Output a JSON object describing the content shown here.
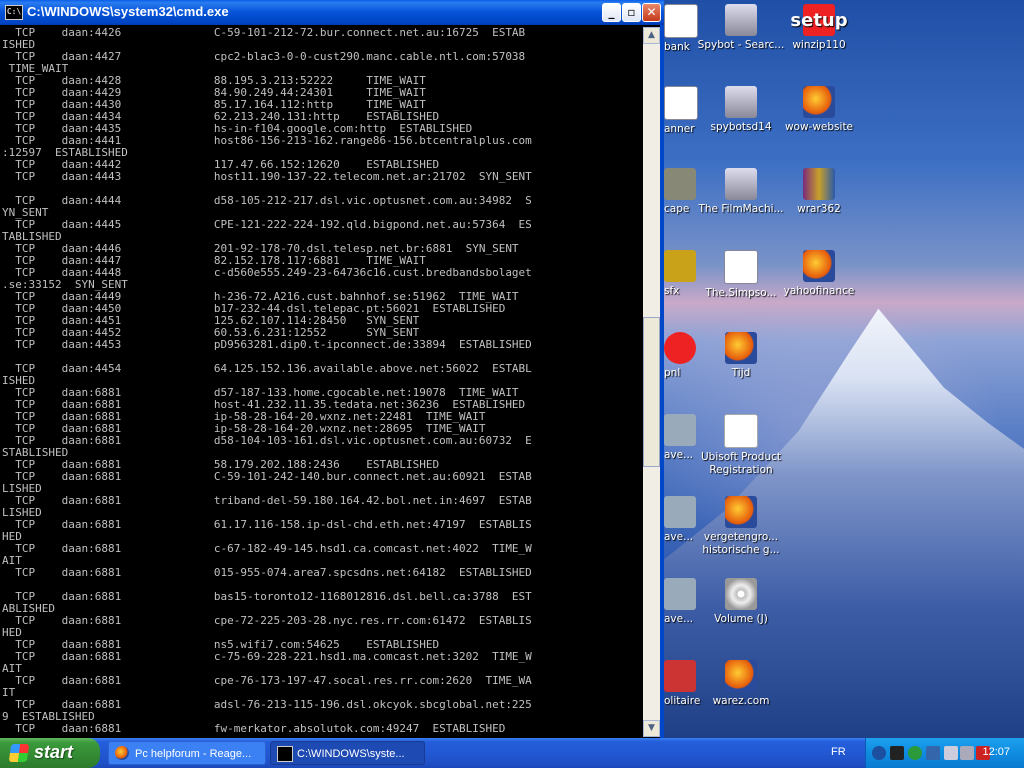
{
  "window": {
    "title": "C:\\WINDOWS\\system32\\cmd.exe",
    "icon_text": "C:\\",
    "minimize": "_",
    "restore": "▫",
    "close": "✕"
  },
  "console_lines": [
    "  TCP    daan:4426              C-59-101-212-72.bur.connect.net.au:16725  ESTAB",
    "ISHED",
    "  TCP    daan:4427              cpc2-blac3-0-0-cust290.manc.cable.ntl.com:57038",
    " TIME_WAIT",
    "  TCP    daan:4428              88.195.3.213:52222     TIME_WAIT",
    "  TCP    daan:4429              84.90.249.44:24301     TIME_WAIT",
    "  TCP    daan:4430              85.17.164.112:http     TIME_WAIT",
    "  TCP    daan:4434              62.213.240.131:http    ESTABLISHED",
    "  TCP    daan:4435              hs-in-f104.google.com:http  ESTABLISHED",
    "  TCP    daan:4441              host86-156-213-162.range86-156.btcentralplus.com",
    ":12597  ESTABLISHED",
    "  TCP    daan:4442              117.47.66.152:12620    ESTABLISHED",
    "  TCP    daan:4443              host11.190-137-22.telecom.net.ar:21702  SYN_SENT",
    "",
    "  TCP    daan:4444              d58-105-212-217.dsl.vic.optusnet.com.au:34982  S",
    "YN_SENT",
    "  TCP    daan:4445              CPE-121-222-224-192.qld.bigpond.net.au:57364  ES",
    "TABLISHED",
    "  TCP    daan:4446              201-92-178-70.dsl.telesp.net.br:6881  SYN_SENT",
    "  TCP    daan:4447              82.152.178.117:6881    TIME_WAIT",
    "  TCP    daan:4448              c-d560e555.249-23-64736c16.cust.bredbandsbolaget",
    ".se:33152  SYN_SENT",
    "  TCP    daan:4449              h-236-72.A216.cust.bahnhof.se:51962  TIME_WAIT",
    "  TCP    daan:4450              b17-232-44.dsl.telepac.pt:56021  ESTABLISHED",
    "  TCP    daan:4451              125.62.107.114:28450   SYN_SENT",
    "  TCP    daan:4452              60.53.6.231:12552      SYN_SENT",
    "  TCP    daan:4453              pD9563281.dip0.t-ipconnect.de:33894  ESTABLISHED",
    "",
    "  TCP    daan:4454              64.125.152.136.available.above.net:56022  ESTABL",
    "ISHED",
    "  TCP    daan:6881              d57-187-133.home.cgocable.net:19078  TIME_WAIT",
    "  TCP    daan:6881              host-41.232.11.35.tedata.net:36236  ESTABLISHED",
    "  TCP    daan:6881              ip-58-28-164-20.wxnz.net:22481  TIME_WAIT",
    "  TCP    daan:6881              ip-58-28-164-20.wxnz.net:28695  TIME_WAIT",
    "  TCP    daan:6881              d58-104-103-161.dsl.vic.optusnet.com.au:60732  E",
    "STABLISHED",
    "  TCP    daan:6881              58.179.202.188:2436    ESTABLISHED",
    "  TCP    daan:6881              C-59-101-242-140.bur.connect.net.au:60921  ESTAB",
    "LISHED",
    "  TCP    daan:6881              triband-del-59.180.164.42.bol.net.in:4697  ESTAB",
    "LISHED",
    "  TCP    daan:6881              61.17.116-158.ip-dsl-chd.eth.net:47197  ESTABLIS",
    "HED",
    "  TCP    daan:6881              c-67-182-49-145.hsd1.ca.comcast.net:4022  TIME_W",
    "AIT",
    "  TCP    daan:6881              015-955-074.area7.spcsdns.net:64182  ESTABLISHED",
    "",
    "  TCP    daan:6881              bas15-toronto12-1168012816.dsl.bell.ca:3788  EST",
    "ABLISHED",
    "  TCP    daan:6881              cpe-72-225-203-28.nyc.res.rr.com:61472  ESTABLIS",
    "HED",
    "  TCP    daan:6881              ns5.wifi7.com:54625    ESTABLISHED",
    "  TCP    daan:6881              c-75-69-228-221.hsd1.ma.comcast.net:3202  TIME_W",
    "AIT",
    "  TCP    daan:6881              cpe-76-173-197-47.socal.res.rr.com:2620  TIME_WA",
    "IT",
    "  TCP    daan:6881              adsl-76-213-115-196.dsl.okcyok.sbcglobal.net:225",
    "9  ESTABLISHED",
    "  TCP    daan:6881              fw-merkator.absolutok.com:49247  ESTABLISHED"
  ],
  "scrollbar": {
    "up": "▲",
    "down": "▼"
  },
  "desktop_icons": [
    {
      "label": "bank",
      "icon": "document-icon"
    },
    {
      "label": "Spybot - Searc...",
      "icon": "spybot-icon"
    },
    {
      "label": "winzip110",
      "icon": "setup-icon",
      "glyph": "setup"
    },
    {
      "label": "anner",
      "icon": "document-icon"
    },
    {
      "label": "spybotsd14",
      "icon": "spybot-icon"
    },
    {
      "label": "wow-website",
      "icon": "firefox-icon"
    },
    {
      "label": "cape",
      "icon": "app-icon"
    },
    {
      "label": "The FilmMachi...",
      "icon": "spybot-icon"
    },
    {
      "label": "wrar362",
      "icon": "winrar-icon"
    },
    {
      "label": "sfx",
      "icon": "app-icon"
    },
    {
      "label": "The.Simpso...",
      "icon": "document-icon"
    },
    {
      "label": "yahoofinance",
      "icon": "firefox-icon"
    },
    {
      "label": "pnl",
      "icon": "app-icon"
    },
    {
      "label": "Tijd",
      "icon": "firefox-icon"
    },
    {
      "label": "ave...",
      "icon": "app-icon"
    },
    {
      "label": "Ubisoft Product Registration",
      "icon": "pen-icon"
    },
    {
      "label": "ave...",
      "icon": "app-icon"
    },
    {
      "label": "vergetengro... historische g...",
      "icon": "firefox-icon"
    },
    {
      "label": "ave...",
      "icon": "app-icon"
    },
    {
      "label": "Volume (J)",
      "icon": "cd-icon"
    },
    {
      "label": "olitaire",
      "icon": "app-icon"
    },
    {
      "label": "warez.com",
      "icon": "firefox-icon"
    }
  ],
  "taskbar": {
    "start_label": "start",
    "tasks": [
      {
        "label": "Pc helpforum - Reage...",
        "icon": "firefox-icon"
      },
      {
        "label": "C:\\WINDOWS\\syste...",
        "icon": "cmd-icon"
      }
    ],
    "language": "FR",
    "clock": "12:07"
  }
}
